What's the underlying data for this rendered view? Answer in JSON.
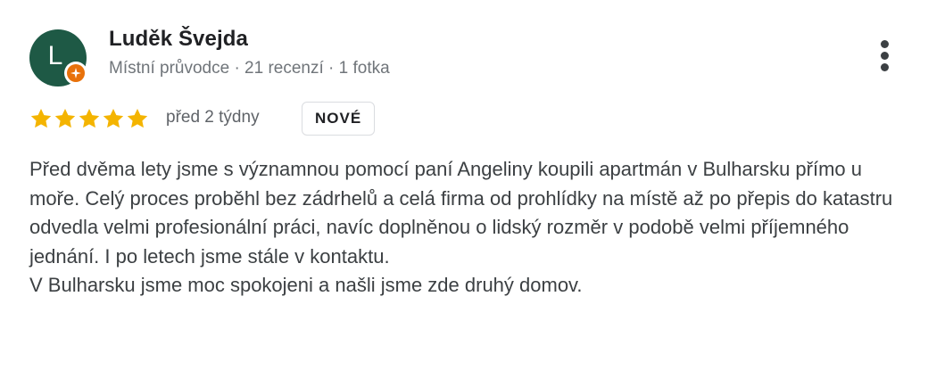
{
  "reviewer": {
    "avatar_letter": "L",
    "avatar_color": "#1e5945",
    "name": "Luděk Švejda",
    "meta": "Místní průvodce · 21 recenzí · 1 fotka",
    "badge_icon": "local-guide-star-icon",
    "badge_color": "#e8710a"
  },
  "rating": {
    "stars": 5,
    "max_stars": 5,
    "star_color": "#f4b400",
    "date": "před 2 týdny",
    "new_badge": "NOVÉ"
  },
  "menu_icon": "more-vert-icon",
  "review": {
    "paragraphs": [
      "Před dvěma lety jsme s významnou pomocí paní Angeliny koupili apartmán v Bulharsku přímo u moře. Celý proces proběhl bez zádrhelů a celá firma od prohlídky na místě až po přepis do katastru odvedla velmi profesionální práci, navíc doplněnou o lidský rozměr v podobě velmi příjemného jednání. I po letech jsme stále v kontaktu.",
      "V Bulharsku jsme moc spokojeni a našli jsme zde druhý domov."
    ]
  }
}
